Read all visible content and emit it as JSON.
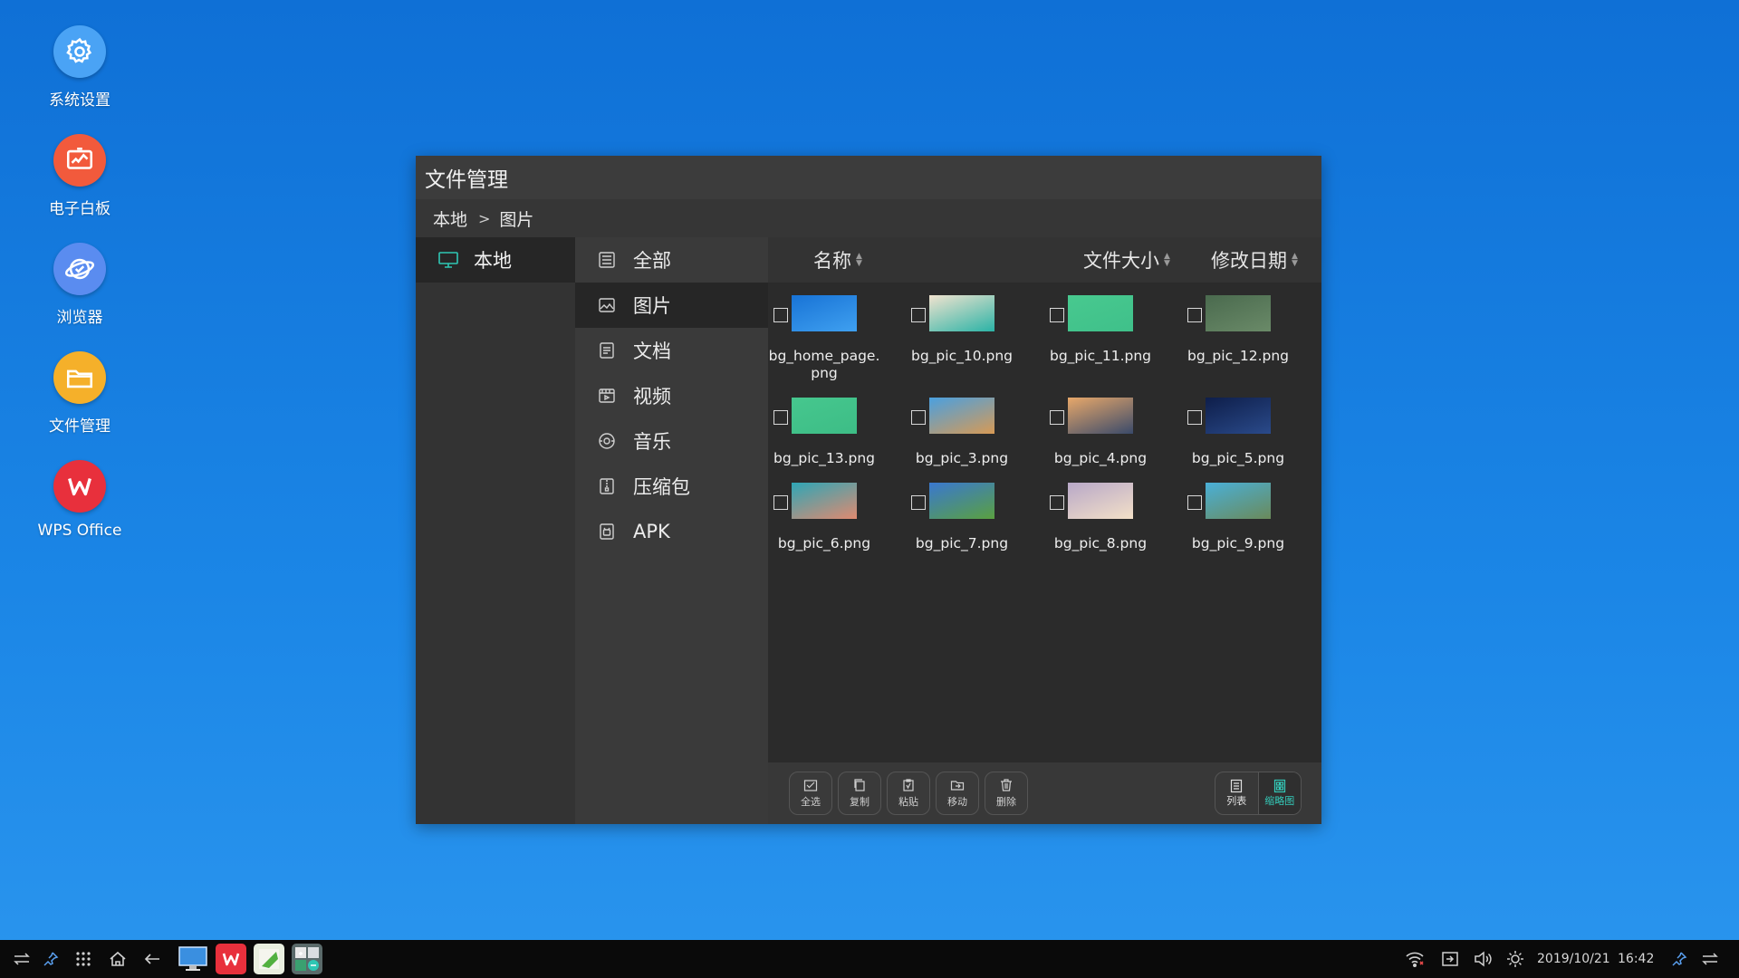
{
  "desktop": {
    "items": [
      {
        "label": "系统设置",
        "icon": "gear-icon",
        "color": "#4aa3f5"
      },
      {
        "label": "电子白板",
        "icon": "whiteboard-icon",
        "color": "#f25a3c"
      },
      {
        "label": "浏览器",
        "icon": "browser-icon",
        "color": "#5a8cf0"
      },
      {
        "label": "文件管理",
        "icon": "folder-icon",
        "color": "#f5b02a"
      },
      {
        "label": "WPS Office",
        "icon": "wps-icon",
        "color": "#e8303c"
      }
    ]
  },
  "window": {
    "title": "文件管理",
    "breadcrumb": {
      "root": "本地",
      "separator": ">",
      "current": "图片"
    },
    "location": {
      "label": "本地"
    },
    "categories": [
      {
        "label": "全部",
        "icon": "all-files-icon"
      },
      {
        "label": "图片",
        "icon": "image-icon",
        "active": true
      },
      {
        "label": "文档",
        "icon": "document-icon"
      },
      {
        "label": "视频",
        "icon": "video-icon"
      },
      {
        "label": "音乐",
        "icon": "music-icon"
      },
      {
        "label": "压缩包",
        "icon": "archive-icon"
      },
      {
        "label": "APK",
        "icon": "apk-icon"
      }
    ],
    "columns": {
      "name": "名称",
      "size": "文件大小",
      "date": "修改日期"
    },
    "files": [
      {
        "name": "bg_home_page.png",
        "thumb": [
          "#1873d6",
          "#3fa0f0"
        ]
      },
      {
        "name": "bg_pic_10.png",
        "thumb": [
          "#f1e3cf",
          "#2bb3a6"
        ]
      },
      {
        "name": "bg_pic_11.png",
        "thumb": [
          "#48c98f",
          "#3fc08a"
        ]
      },
      {
        "name": "bg_pic_12.png",
        "thumb": [
          "#4a6a4e",
          "#6a8a68"
        ]
      },
      {
        "name": "bg_pic_13.png",
        "thumb": [
          "#46c78e",
          "#3dbd86"
        ]
      },
      {
        "name": "bg_pic_3.png",
        "thumb": [
          "#4aa0e0",
          "#d79a55"
        ]
      },
      {
        "name": "bg_pic_4.png",
        "thumb": [
          "#e8a86a",
          "#3a4a6a"
        ]
      },
      {
        "name": "bg_pic_5.png",
        "thumb": [
          "#0e1e4a",
          "#2a4a8a"
        ]
      },
      {
        "name": "bg_pic_6.png",
        "thumb": [
          "#2ea6b6",
          "#e08a70"
        ]
      },
      {
        "name": "bg_pic_7.png",
        "thumb": [
          "#3a78d0",
          "#5aa040"
        ]
      },
      {
        "name": "bg_pic_8.png",
        "thumb": [
          "#b8a8c8",
          "#f3e0c8"
        ]
      },
      {
        "name": "bg_pic_9.png",
        "thumb": [
          "#4ab0d8",
          "#6a8a5a"
        ]
      }
    ],
    "toolbar": {
      "buttons": [
        {
          "label": "全选",
          "icon": "select-all-icon"
        },
        {
          "label": "复制",
          "icon": "copy-icon"
        },
        {
          "label": "粘贴",
          "icon": "paste-icon"
        },
        {
          "label": "移动",
          "icon": "move-icon"
        },
        {
          "label": "删除",
          "icon": "delete-icon"
        }
      ],
      "views": [
        {
          "label": "列表",
          "icon": "list-view-icon"
        },
        {
          "label": "缩略图",
          "icon": "thumbnail-view-icon",
          "active": true
        }
      ]
    }
  },
  "taskbar": {
    "date": "2019/10/21",
    "time": "16:42",
    "accent": "#34c9b8"
  }
}
